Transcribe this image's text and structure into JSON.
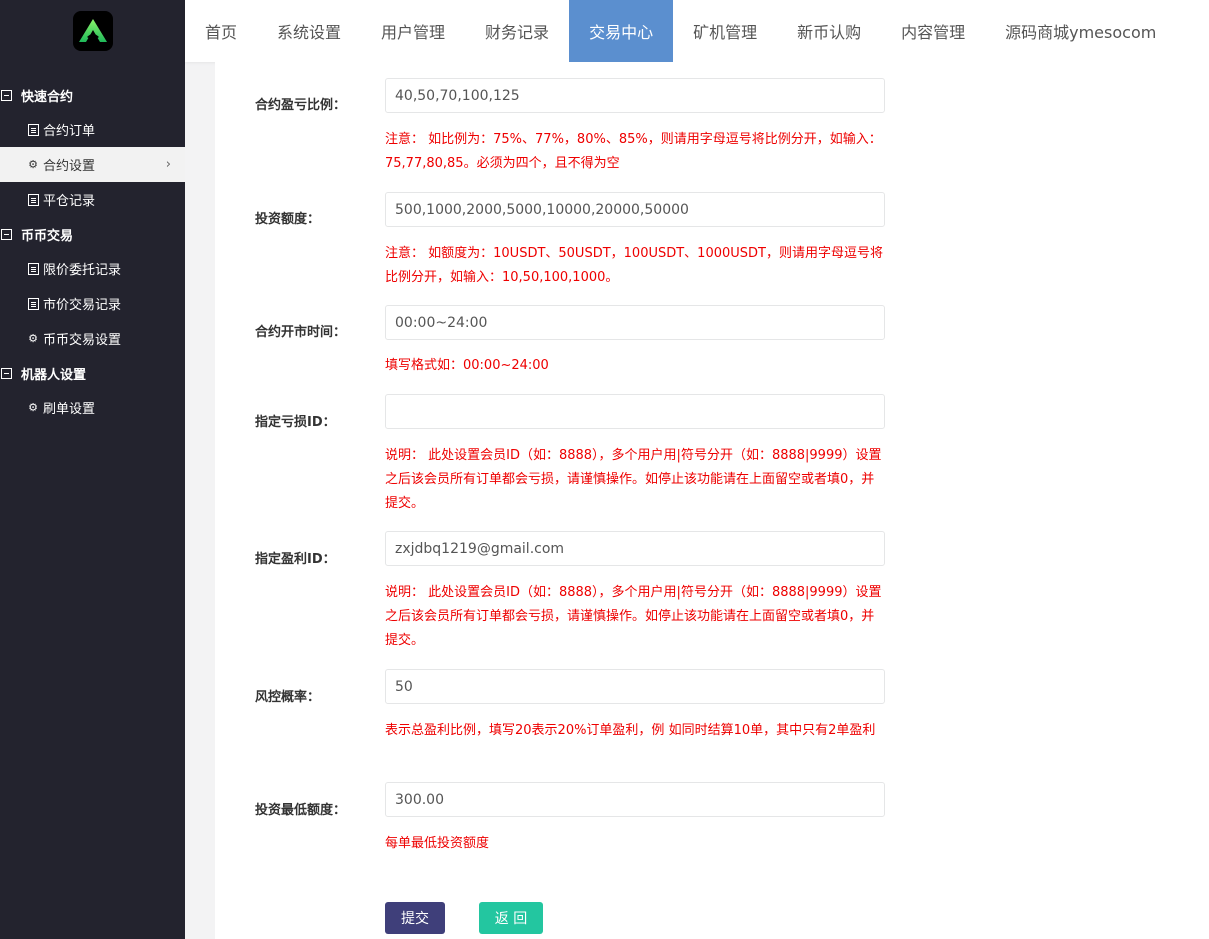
{
  "sidebar": {
    "groups": [
      {
        "label": "快速合约",
        "items": [
          {
            "label": "合约订单",
            "icon": "doc-icon"
          },
          {
            "label": "合约设置",
            "icon": "gear-icon",
            "active": true
          },
          {
            "label": "平仓记录",
            "icon": "doc-icon"
          }
        ]
      },
      {
        "label": "币币交易",
        "items": [
          {
            "label": "限价委托记录",
            "icon": "doc-icon"
          },
          {
            "label": "市价交易记录",
            "icon": "doc-icon"
          },
          {
            "label": "币币交易设置",
            "icon": "gear-icon"
          }
        ]
      },
      {
        "label": "机器人设置",
        "items": [
          {
            "label": "刷单设置",
            "icon": "gear-icon"
          }
        ]
      }
    ]
  },
  "topnav": {
    "tabs": [
      "首页",
      "系统设置",
      "用户管理",
      "财务记录",
      "交易中心",
      "矿机管理",
      "新币认购",
      "内容管理",
      "源码商城ymesocom"
    ],
    "active_index": 4,
    "active_color": "#5b8fcf"
  },
  "form": {
    "fields": [
      {
        "label": "合约盈亏比例：",
        "value": "40,50,70,100,125",
        "placeholder": "",
        "hint": "注意： 如比例为：75%、77%，80%、85%，则请用字母逗号将比例分开，如输入：75,77,80,85。必须为四个，且不得为空"
      },
      {
        "label": "投资额度：",
        "value": "500,1000,2000,5000,10000,20000,50000",
        "placeholder": "",
        "hint": "注意： 如额度为：10USDT、50USDT，100USDT、1000USDT，则请用字母逗号将比例分开，如输入：10,50,100,1000。"
      },
      {
        "label": "合约开市时间：",
        "value": "00:00~24:00",
        "placeholder": "",
        "hint": "填写格式如：00:00~24:00"
      },
      {
        "label": "指定亏损ID：",
        "value": "",
        "placeholder": "",
        "hint": "说明： 此处设置会员ID（如：8888），多个用户用|符号分开（如：8888|9999）设置之后该会员所有订单都会亏损，请谨慎操作。如停止该功能请在上面留空或者填0，并提交。"
      },
      {
        "label": "指定盈利ID：",
        "value": "zxjdbq1219@gmail.com",
        "placeholder": "",
        "hint": "说明： 此处设置会员ID（如：8888），多个用户用|符号分开（如：8888|9999）设置之后该会员所有订单都会亏损，请谨慎操作。如停止该功能请在上面留空或者填0，并提交。"
      },
      {
        "label": "风控概率：",
        "value": "50",
        "placeholder": "",
        "hint": "表示总盈利比例，填写20表示20%订单盈利，例 如同时结算10单，其中只有2单盈利"
      },
      {
        "label": "投资最低额度：",
        "value": "300.00",
        "placeholder": "",
        "hint": "每单最低投资额度"
      }
    ],
    "submit_label": "提交",
    "back_label": "返 回",
    "hint_color": "#e00000"
  }
}
